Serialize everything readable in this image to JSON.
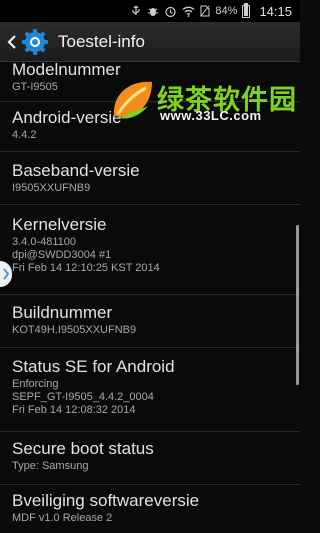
{
  "status_bar": {
    "battery_text": "84%",
    "battery_level": 0.84,
    "time": "14:15",
    "icons": [
      "usb-icon",
      "debug-icon",
      "alarm-icon",
      "wifi-icon",
      "no-sim-icon"
    ]
  },
  "action_bar": {
    "title": "Toestel-info",
    "accent": "#1e88d8"
  },
  "items": [
    {
      "label": "Modelnummer",
      "values": [
        "GT-I9505"
      ]
    },
    {
      "label": "Android-versie",
      "values": [
        "4.4.2"
      ]
    },
    {
      "label": "Baseband-versie",
      "values": [
        "I9505XXUFNB9"
      ]
    },
    {
      "label": "Kernelversie",
      "values": [
        "3.4.0-481100",
        "dpi@SWDD3004 #1",
        "Fri Feb 14 12:10:25 KST 2014"
      ]
    },
    {
      "label": "Buildnummer",
      "values": [
        "KOT49H.I9505XXUFNB9"
      ]
    },
    {
      "label": "Status SE for Android",
      "values": [
        "Enforcing",
        "SEPF_GT-I9505_4.4.2_0004",
        "Fri Feb 14 12:08:32 2014"
      ]
    },
    {
      "label": "Secure boot status",
      "values": [
        "Type: Samsung"
      ]
    },
    {
      "label": "Bveiliging softwareversie",
      "values": [
        "MDF v1.0 Release 2"
      ]
    }
  ],
  "watermark": {
    "text": "绿茶软件园",
    "url": "www.33LC.com",
    "color": "#7ed321"
  }
}
